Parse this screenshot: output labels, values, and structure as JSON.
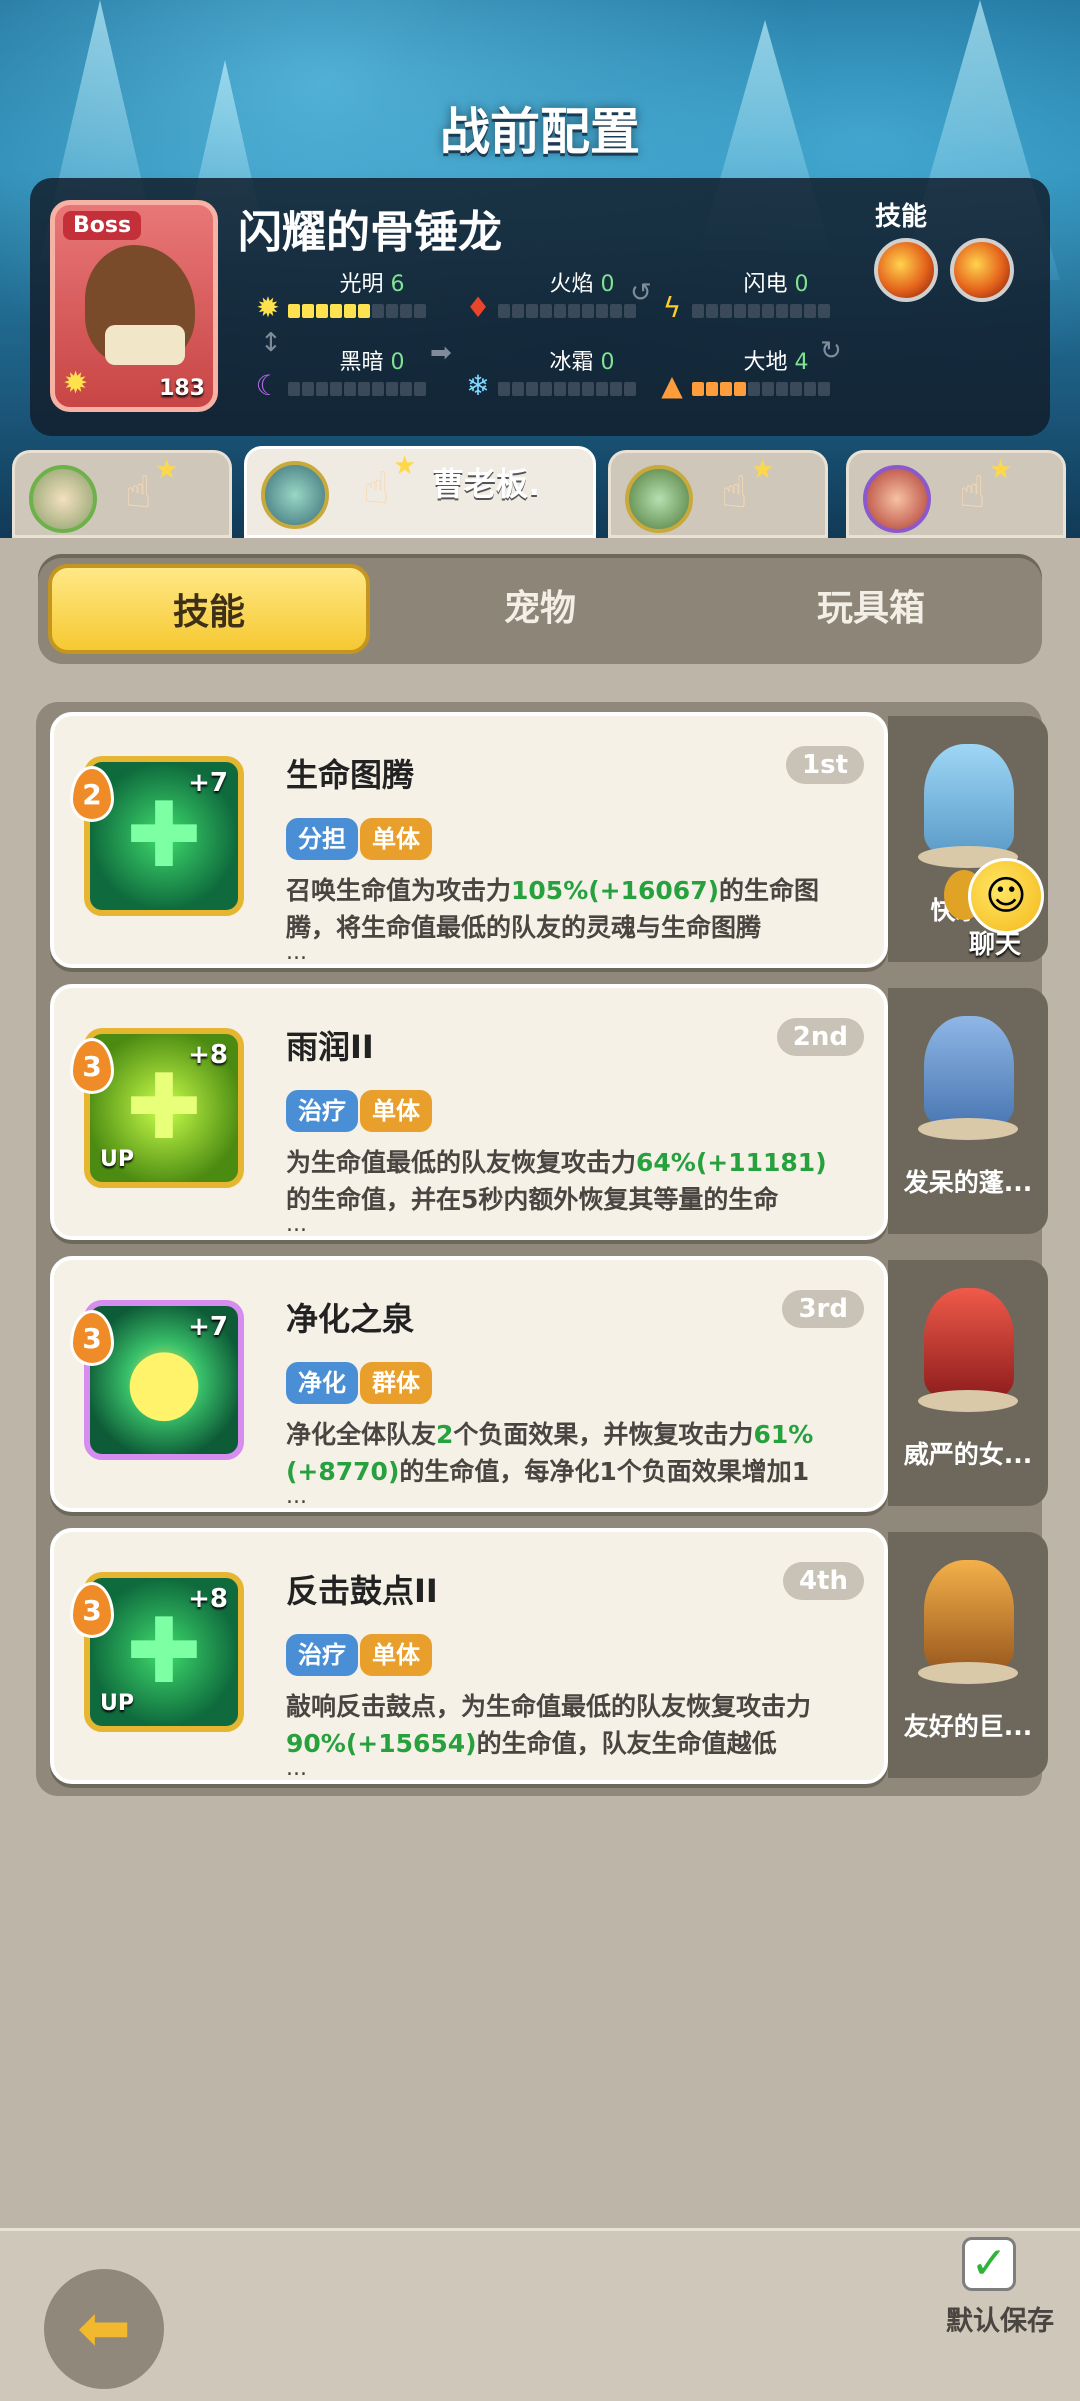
{
  "header": {
    "title": "战前配置"
  },
  "boss": {
    "tag": "Boss",
    "name": "闪耀的骨锤龙",
    "level": "183",
    "skills_label": "技能",
    "elements": [
      {
        "label": "光明",
        "value": "6",
        "icon": "light-icon"
      },
      {
        "label": "火焰",
        "value": "0",
        "icon": "fire-icon"
      },
      {
        "label": "闪电",
        "value": "0",
        "icon": "lightning-icon"
      },
      {
        "label": "黑暗",
        "value": "0",
        "icon": "dark-icon"
      },
      {
        "label": "冰霜",
        "value": "0",
        "icon": "frost-icon"
      },
      {
        "label": "大地",
        "value": "4",
        "icon": "earth-icon"
      }
    ]
  },
  "hero_tabs": [
    {
      "name": ""
    },
    {
      "name": "曹老板."
    },
    {
      "name": ""
    },
    {
      "name": ""
    }
  ],
  "segments": [
    "技能",
    "宠物",
    "玩具箱"
  ],
  "skills": [
    {
      "level": "2",
      "plus": "+7",
      "up": "",
      "name": "生命图腾",
      "rank": "1st",
      "tags": [
        "分担",
        "单体"
      ],
      "desc_parts": [
        "召唤生命值为攻击力",
        "105%(+16067)",
        "的生命图腾，将生命值最低的队友的灵魂与生命图腾"
      ],
      "more": "...",
      "pet": "快乐…"
    },
    {
      "level": "3",
      "plus": "+8",
      "up": "UP",
      "name": "雨润II",
      "rank": "2nd",
      "tags": [
        "治疗",
        "单体"
      ],
      "desc_parts": [
        "为生命值最低的队友恢复攻击力",
        "64%(+11181)",
        "的生命值，并在5秒内额外恢复其等量的生命"
      ],
      "more": "...",
      "pet": "发呆的蓬..."
    },
    {
      "level": "3",
      "plus": "+7",
      "up": "",
      "name": "净化之泉",
      "rank": "3rd",
      "tags": [
        "净化",
        "群体"
      ],
      "desc_parts": [
        "净化全体队友",
        "2",
        "个负面效果，并恢复攻击力",
        "61%(+8770)",
        "的生命值，每净化1个负面效果增加1"
      ],
      "more": "...",
      "pet": "威严的女..."
    },
    {
      "level": "3",
      "plus": "+8",
      "up": "UP",
      "name": "反击鼓点II",
      "rank": "4th",
      "tags": [
        "治疗",
        "单体"
      ],
      "desc_parts": [
        "敲响反击鼓点，为生命值最低的队友恢复攻击力",
        "90%(+15654)",
        "的生命值，队友生命值越低"
      ],
      "more": "...",
      "pet": "友好的巨..."
    }
  ],
  "chat": {
    "label": "聊天"
  },
  "footer": {
    "save_label": "默认保存"
  }
}
